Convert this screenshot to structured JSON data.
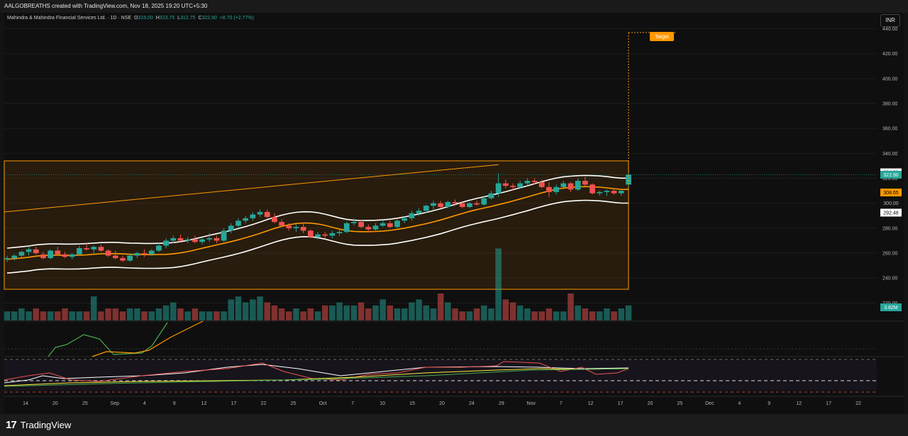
{
  "header": {
    "created_text": "AALGOBREATHS created with TradingView.com, Nov 18, 2025 19:20 UTC+5:30"
  },
  "legend": {
    "symbol": "Mahindra & Mahindra Financial Services Ltd. · 1D · NSE",
    "open_label": "O",
    "open": "315.00",
    "high_label": "H",
    "high": "323.75",
    "low_label": "L",
    "low": "312.75",
    "close_label": "C",
    "close": "322.90",
    "change": "+8.70 (+2.77%)"
  },
  "currency": "INR",
  "target_label": "Target",
  "volume_tag": "3.82M",
  "branding": {
    "mark": "17",
    "name": "TradingView"
  },
  "colors": {
    "up": "#26a69a",
    "down": "#ef5350",
    "channel": "#ff9800",
    "band": "#ffffff",
    "mid": "#ff9800",
    "target": "#ff9800"
  },
  "chart_data": {
    "type": "candlestick",
    "y_ticks": [
      220,
      240,
      260,
      280,
      300,
      320,
      340,
      360,
      380,
      400,
      420,
      440
    ],
    "ylim": [
      206,
      446
    ],
    "x_ticks": [
      "14",
      "20",
      "25",
      "Sep",
      "4",
      "9",
      "12",
      "17",
      "22",
      "25",
      "Oct",
      "7",
      "10",
      "15",
      "20",
      "24",
      "29",
      "Nov",
      "7",
      "12",
      "17",
      "20",
      "25",
      "Dec",
      "4",
      "9",
      "12",
      "17",
      "22"
    ],
    "price_tags": [
      {
        "value": 324.83,
        "label": "324.83",
        "style": "light"
      },
      {
        "value": 322.9,
        "label": "322.90",
        "style": "up"
      },
      {
        "value": 308.65,
        "label": "308.65",
        "style": "orange"
      },
      {
        "value": 300.0,
        "label": "300.00",
        "style": "plain"
      },
      {
        "value": 292.48,
        "label": "292.48",
        "style": "light"
      }
    ],
    "range_box": {
      "top": 334,
      "bottom": 231
    },
    "target": {
      "value": 437
    },
    "candles": [
      [
        255,
        258,
        253,
        256
      ],
      [
        256,
        259,
        254,
        258
      ],
      [
        258,
        262,
        256,
        261
      ],
      [
        261,
        265,
        258,
        263
      ],
      [
        263,
        265,
        259,
        260
      ],
      [
        259,
        261,
        255,
        256
      ],
      [
        256,
        263,
        255,
        262
      ],
      [
        262,
        265,
        258,
        259
      ],
      [
        259,
        261,
        256,
        257
      ],
      [
        257,
        260,
        255,
        259
      ],
      [
        259,
        266,
        258,
        264
      ],
      [
        264,
        268,
        262,
        263
      ],
      [
        263,
        266,
        260,
        265
      ],
      [
        265,
        267,
        261,
        262
      ],
      [
        262,
        263,
        257,
        258
      ],
      [
        258,
        262,
        255,
        256
      ],
      [
        256,
        258,
        253,
        254
      ],
      [
        254,
        260,
        253,
        258
      ],
      [
        258,
        261,
        256,
        260
      ],
      [
        260,
        263,
        257,
        259
      ],
      [
        259,
        263,
        258,
        262
      ],
      [
        262,
        268,
        261,
        266
      ],
      [
        266,
        272,
        264,
        270
      ],
      [
        270,
        274,
        268,
        272
      ],
      [
        272,
        275,
        269,
        270
      ],
      [
        270,
        273,
        268,
        271
      ],
      [
        271,
        274,
        268,
        269
      ],
      [
        269,
        272,
        267,
        271
      ],
      [
        271,
        276,
        269,
        272
      ],
      [
        272,
        274,
        268,
        270
      ],
      [
        270,
        280,
        269,
        278
      ],
      [
        278,
        284,
        276,
        282
      ],
      [
        282,
        288,
        280,
        286
      ],
      [
        286,
        290,
        284,
        288
      ],
      [
        288,
        293,
        286,
        291
      ],
      [
        291,
        295,
        289,
        293
      ],
      [
        293,
        295,
        288,
        289
      ],
      [
        289,
        292,
        284,
        285
      ],
      [
        285,
        287,
        281,
        282
      ],
      [
        282,
        284,
        278,
        280
      ],
      [
        280,
        283,
        277,
        281
      ],
      [
        281,
        284,
        276,
        278
      ],
      [
        278,
        279,
        272,
        273
      ],
      [
        273,
        277,
        271,
        275
      ],
      [
        275,
        277,
        272,
        274
      ],
      [
        274,
        278,
        272,
        276
      ],
      [
        276,
        280,
        274,
        277
      ],
      [
        277,
        285,
        276,
        284
      ],
      [
        284,
        288,
        282,
        285
      ],
      [
        285,
        287,
        280,
        281
      ],
      [
        281,
        283,
        277,
        279
      ],
      [
        279,
        284,
        277,
        282
      ],
      [
        282,
        286,
        281,
        284
      ],
      [
        284,
        286,
        280,
        281
      ],
      [
        281,
        287,
        280,
        286
      ],
      [
        286,
        289,
        284,
        288
      ],
      [
        288,
        294,
        286,
        292
      ],
      [
        292,
        296,
        290,
        294
      ],
      [
        294,
        299,
        292,
        298
      ],
      [
        298,
        302,
        295,
        300
      ],
      [
        300,
        302,
        296,
        297
      ],
      [
        297,
        302,
        296,
        301
      ],
      [
        301,
        303,
        298,
        300
      ],
      [
        300,
        301,
        296,
        297
      ],
      [
        297,
        301,
        296,
        300
      ],
      [
        300,
        302,
        298,
        299
      ],
      [
        299,
        306,
        298,
        304
      ],
      [
        304,
        310,
        303,
        308
      ],
      [
        308,
        324,
        305,
        316
      ],
      [
        316,
        319,
        312,
        314
      ],
      [
        314,
        316,
        310,
        313
      ],
      [
        313,
        318,
        312,
        316
      ],
      [
        316,
        320,
        314,
        318
      ],
      [
        318,
        320,
        315,
        317
      ],
      [
        317,
        319,
        312,
        313
      ],
      [
        313,
        317,
        305,
        309
      ],
      [
        309,
        315,
        307,
        313
      ],
      [
        313,
        318,
        311,
        316
      ],
      [
        316,
        317,
        309,
        311
      ],
      [
        311,
        320,
        310,
        318
      ],
      [
        318,
        321,
        314,
        315
      ],
      [
        315,
        316,
        307,
        308
      ],
      [
        308,
        310,
        306,
        309
      ],
      [
        309,
        311,
        306,
        310
      ],
      [
        310,
        312,
        307,
        308
      ],
      [
        308,
        311,
        306,
        310
      ],
      [
        315,
        324,
        313,
        323
      ]
    ],
    "volume": [
      3,
      3,
      4,
      3,
      4,
      3,
      3,
      3,
      4,
      3,
      3,
      3,
      8,
      3,
      4,
      4,
      3,
      4,
      4,
      3,
      3,
      4,
      5,
      6,
      4,
      3,
      4,
      3,
      3,
      3,
      3,
      7,
      8,
      6,
      7,
      8,
      6,
      5,
      4,
      3,
      4,
      3,
      4,
      3,
      5,
      5,
      6,
      5,
      5,
      6,
      4,
      5,
      7,
      5,
      4,
      4,
      6,
      7,
      5,
      4,
      9,
      6,
      4,
      3,
      3,
      4,
      5,
      4,
      24,
      7,
      6,
      5,
      4,
      3,
      3,
      4,
      3,
      3,
      9,
      5,
      4,
      3,
      3,
      4,
      3,
      4,
      5
    ],
    "volume_scale": 26
  }
}
